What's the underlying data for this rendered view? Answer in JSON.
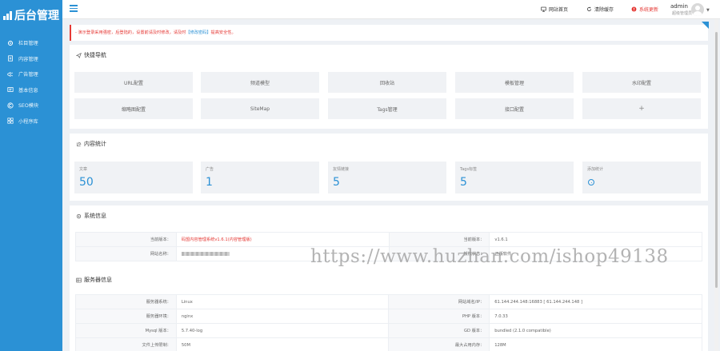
{
  "sidebar": {
    "logo_text": "后台管理",
    "items": [
      {
        "label": "栏目管理",
        "icon": "gear-icon"
      },
      {
        "label": "内容管理",
        "icon": "document-icon"
      },
      {
        "label": "广告管理",
        "icon": "megaphone-icon"
      },
      {
        "label": "基本信息",
        "icon": "info-icon"
      },
      {
        "label": "SEO模块",
        "icon": "copyright-icon"
      },
      {
        "label": "小程序库",
        "icon": "grid-icon"
      }
    ]
  },
  "header": {
    "links": [
      {
        "label": "网站首页",
        "icon": "monitor-icon"
      },
      {
        "label": "清除缓存",
        "icon": "refresh-icon"
      },
      {
        "label": "系统更新",
        "icon": "alert-icon"
      }
    ],
    "user": {
      "name": "admin",
      "role": "超级管理员"
    },
    "accent_color": "#2b91d5",
    "alert_color": "#e53935"
  },
  "notice": {
    "text_before": "- 演示登录采用强密，后登陆的，设置前请及时修改，请及时",
    "link_text": "【修改密码】",
    "text_after": "提高安全性。"
  },
  "quick_nav": {
    "title": "快捷导航",
    "items": [
      "URL配置",
      "频道模型",
      "回收站",
      "模板管理",
      "水印配置",
      "缩略图配置",
      "SiteMap",
      "Tags管理",
      "接口配置",
      "+"
    ]
  },
  "stats": {
    "title": "内容统计",
    "items": [
      {
        "label": "文章",
        "value": "50"
      },
      {
        "label": "广告",
        "value": "1"
      },
      {
        "label": "友情链接",
        "value": "5"
      },
      {
        "label": "Tags标签",
        "value": "5"
      },
      {
        "label": "添加统计",
        "value": ""
      }
    ]
  },
  "system_info": {
    "title": "系统信息",
    "rows": [
      {
        "k1": "当前版本：",
        "v1": "码盟内容管理系统v1.6.1(内容管理版)",
        "k2": "当前版本：",
        "v2": "v1.6.1"
      },
      {
        "k1": "网站名称：",
        "v1": "",
        "k2": "授权状态：",
        "v2": "正版软件"
      }
    ]
  },
  "server_info": {
    "title": "服务器信息",
    "rows": [
      {
        "k1": "服务器系统：",
        "v1": "Linux",
        "k2": "网站域名/IP：",
        "v2": "61.144.244.148:16883 [ 61.144.244.148 ]"
      },
      {
        "k1": "服务器环境：",
        "v1": "nginx",
        "k2": "PHP 版本：",
        "v2": "7.0.33"
      },
      {
        "k1": "Mysql 版本：",
        "v1": "5.7.40-log",
        "k2": "GD 版本：",
        "v2": "bundled (2.1.0 compatible)"
      },
      {
        "k1": "文件上传限制：",
        "v1": "50M",
        "k2": "最大占用内存：",
        "v2": "128M"
      }
    ]
  },
  "watermark": "https://www.huzhan.com/ishop49138"
}
